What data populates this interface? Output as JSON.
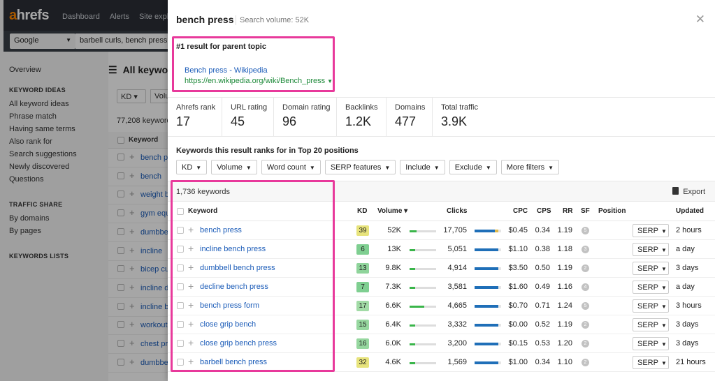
{
  "app": {
    "logo_a": "a",
    "logo_rest": "hrefs",
    "nav": [
      "Dashboard",
      "Alerts",
      "Site explorer"
    ],
    "engine": "Google",
    "query": "barbell curls, bench press, incline",
    "title": "All keywords",
    "sidebar": {
      "overview": "Overview",
      "sections": [
        {
          "title": "KEYWORD IDEAS",
          "items": [
            "All keyword ideas",
            "Phrase match",
            "Having same terms",
            "Also rank for",
            "Search suggestions",
            "Newly discovered",
            "Questions"
          ]
        },
        {
          "title": "TRAFFIC SHARE",
          "items": [
            "By domains",
            "By pages"
          ]
        },
        {
          "title": "KEYWORDS LISTS",
          "items": []
        }
      ]
    },
    "filter_kd": "KD",
    "filter_vol": "Volume",
    "count": "77,208 keywords",
    "col_keyword": "Keyword",
    "keywords": [
      "bench press",
      "bench",
      "weight bench",
      "gym equipment",
      "dumbbells",
      "incline",
      "bicep curls",
      "incline dumbbell",
      "incline bench",
      "workout",
      "chest press",
      "dumbbell"
    ]
  },
  "panel": {
    "title": "bench press",
    "volume": "Search volume: 52K",
    "parent_header": "#1 result for parent topic",
    "parent_title": "Bench press - Wikipedia",
    "parent_url": "https://en.wikipedia.org/wiki/Bench_press",
    "metrics": [
      {
        "label": "Ahrefs rank",
        "value": "17"
      },
      {
        "label": "URL rating",
        "value": "45"
      },
      {
        "label": "Domain rating",
        "value": "96"
      },
      {
        "label": "Backlinks",
        "value": "1.2K"
      },
      {
        "label": "Domains",
        "value": "477"
      },
      {
        "label": "Total traffic",
        "value": "3.9K"
      }
    ],
    "ranks_header": "Keywords this result ranks for in Top 20 positions",
    "filters": [
      "KD",
      "Volume",
      "Word count",
      "SERP features",
      "Include",
      "Exclude",
      "More filters"
    ],
    "count": "1,736 keywords",
    "export": "Export",
    "columns": {
      "keyword": "Keyword",
      "kd": "KD",
      "volume": "Volume",
      "clicks": "Clicks",
      "cpc": "CPC",
      "cps": "CPS",
      "rr": "RR",
      "sf": "SF",
      "position": "Position",
      "updated": "Updated"
    },
    "serp_label": "SERP",
    "rows": [
      {
        "keyword": "bench press",
        "kd": "39",
        "kd_color": "#e7e37c",
        "volume": "52K",
        "vol_frac": 0.25,
        "clicks": "17,705",
        "click_frac": 0.75,
        "click_extra": 0.15,
        "cpc": "$0.45",
        "cps": "0.34",
        "rr": "1.19",
        "sf": "5",
        "updated": "2 hours"
      },
      {
        "keyword": "incline bench press",
        "kd": "6",
        "kd_color": "#7fcf91",
        "volume": "13K",
        "vol_frac": 0.22,
        "clicks": "5,051",
        "click_frac": 0.9,
        "click_extra": 0,
        "cpc": "$1.10",
        "cps": "0.38",
        "rr": "1.18",
        "sf": "3",
        "updated": "a day"
      },
      {
        "keyword": "dumbbell bench press",
        "kd": "13",
        "kd_color": "#8fd49b",
        "volume": "9.8K",
        "vol_frac": 0.22,
        "clicks": "4,914",
        "click_frac": 0.9,
        "click_extra": 0,
        "cpc": "$3.50",
        "cps": "0.50",
        "rr": "1.19",
        "sf": "2",
        "updated": "3 days"
      },
      {
        "keyword": "decline bench press",
        "kd": "7",
        "kd_color": "#7fcf91",
        "volume": "7.3K",
        "vol_frac": 0.22,
        "clicks": "3,581",
        "click_frac": 0.9,
        "click_extra": 0,
        "cpc": "$1.60",
        "cps": "0.49",
        "rr": "1.16",
        "sf": "4",
        "updated": "a day"
      },
      {
        "keyword": "bench press form",
        "kd": "17",
        "kd_color": "#a2dba6",
        "volume": "6.6K",
        "vol_frac": 0.55,
        "clicks": "4,665",
        "click_frac": 0.9,
        "click_extra": 0,
        "cpc": "$0.70",
        "cps": "0.71",
        "rr": "1.24",
        "sf": "5",
        "updated": "3 hours"
      },
      {
        "keyword": "close grip bench",
        "kd": "15",
        "kd_color": "#96d79f",
        "volume": "6.4K",
        "vol_frac": 0.22,
        "clicks": "3,332",
        "click_frac": 0.9,
        "click_extra": 0,
        "cpc": "$0.00",
        "cps": "0.52",
        "rr": "1.19",
        "sf": "2",
        "updated": "3 days"
      },
      {
        "keyword": "close grip bench press",
        "kd": "16",
        "kd_color": "#96d79f",
        "volume": "6.0K",
        "vol_frac": 0.22,
        "clicks": "3,200",
        "click_frac": 0.9,
        "click_extra": 0,
        "cpc": "$0.15",
        "cps": "0.53",
        "rr": "1.20",
        "sf": "2",
        "updated": "3 days"
      },
      {
        "keyword": "barbell bench press",
        "kd": "32",
        "kd_color": "#e7e37c",
        "volume": "4.6K",
        "vol_frac": 0.22,
        "clicks": "1,569",
        "click_frac": 0.9,
        "click_extra": 0,
        "cpc": "$1.00",
        "cps": "0.34",
        "rr": "1.10",
        "sf": "2",
        "updated": "21 hours"
      }
    ]
  },
  "colors": {
    "highlight": "#e8399b",
    "link": "#1a5bb8",
    "url": "#1e8a3a",
    "volume_bar": "#3ab54a",
    "clicks_bar": "#1f6fb8"
  }
}
